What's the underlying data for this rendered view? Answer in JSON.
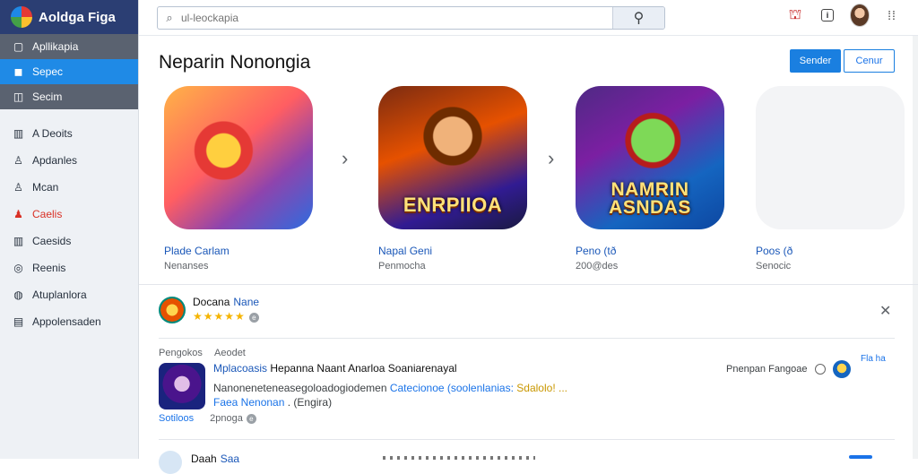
{
  "brand": {
    "title": "Aoldga Figa"
  },
  "sidebar": {
    "items": [
      {
        "label": "Apllikapia",
        "icon": "window-icon"
      },
      {
        "label": "Sepec",
        "icon": "apps-icon"
      },
      {
        "label": "Secim",
        "icon": "bag-icon"
      },
      {
        "label": "A Deoits",
        "icon": "bars-icon"
      },
      {
        "label": "Apdanles",
        "icon": "person-icon"
      },
      {
        "label": "Mcan",
        "icon": "person-icon"
      },
      {
        "label": "Caelis",
        "icon": "users-icon",
        "color": "#d93025"
      },
      {
        "label": "Caesids",
        "icon": "bars-icon"
      },
      {
        "label": "Reenis",
        "icon": "compass-icon"
      },
      {
        "label": "Atuplanlora",
        "icon": "shield-icon"
      },
      {
        "label": "Appolensaden",
        "icon": "doc-icon"
      }
    ]
  },
  "search": {
    "placeholder": "ul-leockapia"
  },
  "main": {
    "title": "Neparin Nonongia",
    "primary_button": "Sender",
    "secondary_button": "Cenur",
    "cards": [
      {
        "title": "Plade Carlam",
        "sub": "Nenanses",
        "art_text": ""
      },
      {
        "title": "Napal Geni",
        "sub": "Penmocha",
        "art_text": "ENRPIIOA"
      },
      {
        "title": "Peno (tð",
        "sub": "200@des",
        "art_text": "NAMRIN ASNDAS"
      },
      {
        "title": "Poos (ð",
        "sub": "Senocic",
        "art_text": ""
      }
    ]
  },
  "review": {
    "name_part1": "Docana",
    "name_part2": "Nane",
    "stars": "★★★★★"
  },
  "listing": {
    "meta_a": "Pengokos",
    "meta_b": "Aeodet",
    "title_link": "Mplacoasis",
    "title_rest": "Hepanna Naant Anarloa Soaniarenayal",
    "desc_a": "Nanoneneteneasegoloadogiodemen",
    "desc_link": "Catecionoe (soolenlanias:",
    "desc_yellow": "Sdalolo! ...",
    "desc2_link": "Faea Nenonan",
    "desc2_rest": ". (Engira)",
    "foot_link": "Sotiloos",
    "foot_count": "2pnoga",
    "right_text": "Pnenpan Fangoae",
    "right_link": "Fla ha"
  },
  "bottom": {
    "text": "Daah",
    "highlight": "Saa"
  },
  "colors": {
    "accent": "#1a7fe0",
    "brand_bar": "#2b3e73",
    "active_nav": "#1f8ae6"
  }
}
